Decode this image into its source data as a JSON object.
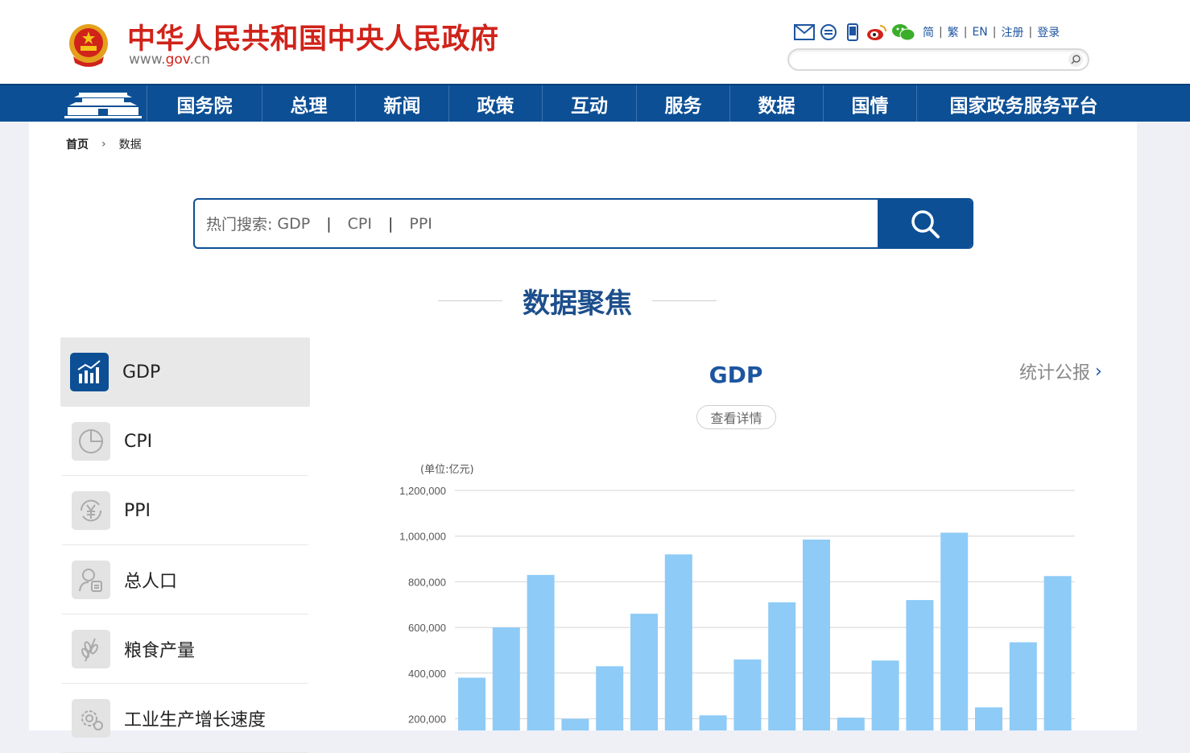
{
  "header": {
    "title": "中华人民共和国中央人民政府",
    "url_prefix": "www.",
    "url_domain": "gov",
    "url_suffix": ".cn",
    "icons": [
      "mail-icon",
      "message-icon",
      "mobile-icon",
      "weibo-icon",
      "wechat-icon"
    ],
    "lang_links": [
      "简",
      "繁",
      "EN",
      "注册",
      "登录"
    ]
  },
  "nav": {
    "items": [
      "国务院",
      "总理",
      "新闻",
      "政策",
      "互动",
      "服务",
      "数据",
      "国情",
      "国家政务服务平台"
    ]
  },
  "breadcrumb": {
    "home": "首页",
    "arrow": "›",
    "current": "数据"
  },
  "search": {
    "hot_label": "热门搜索:",
    "keywords": [
      "GDP",
      "CPI",
      "PPI"
    ],
    "separator": "|"
  },
  "section": {
    "title": "数据聚焦"
  },
  "sidebar": {
    "items": [
      {
        "label": "GDP",
        "icon": "bar-chart-icon",
        "active": true
      },
      {
        "label": "CPI",
        "icon": "pie-chart-icon",
        "active": false
      },
      {
        "label": "PPI",
        "icon": "yuan-cycle-icon",
        "active": false
      },
      {
        "label": "总人口",
        "icon": "person-icon",
        "active": false
      },
      {
        "label": "粮食产量",
        "icon": "wheat-icon",
        "active": false
      },
      {
        "label": "工业生产增长速度",
        "icon": "gear-icon",
        "active": false
      }
    ]
  },
  "panel": {
    "title": "GDP",
    "stat_link": "统计公报",
    "stat_link_chevron": "›",
    "detail_button": "查看详情",
    "unit": "(单位:亿元)"
  },
  "colors": {
    "brand_blue": "#0c4f95",
    "title_red": "#d0231a",
    "bar_color": "#8ecbf7"
  },
  "chart_data": {
    "type": "bar",
    "ylabel": "(单位:亿元)",
    "ylim": [
      0,
      1200000
    ],
    "yticks": [
      "1,200,000",
      "1,000,000",
      "800,000",
      "600,000",
      "400,000",
      "200,000"
    ],
    "ytick_values": [
      1200000,
      1000000,
      800000,
      600000,
      400000,
      200000
    ],
    "values": [
      380000,
      600000,
      830000,
      200000,
      430000,
      660000,
      920000,
      215000,
      460000,
      710000,
      985000,
      205000,
      455000,
      720000,
      1015000,
      250000,
      535000,
      825000
    ],
    "grid": true
  }
}
